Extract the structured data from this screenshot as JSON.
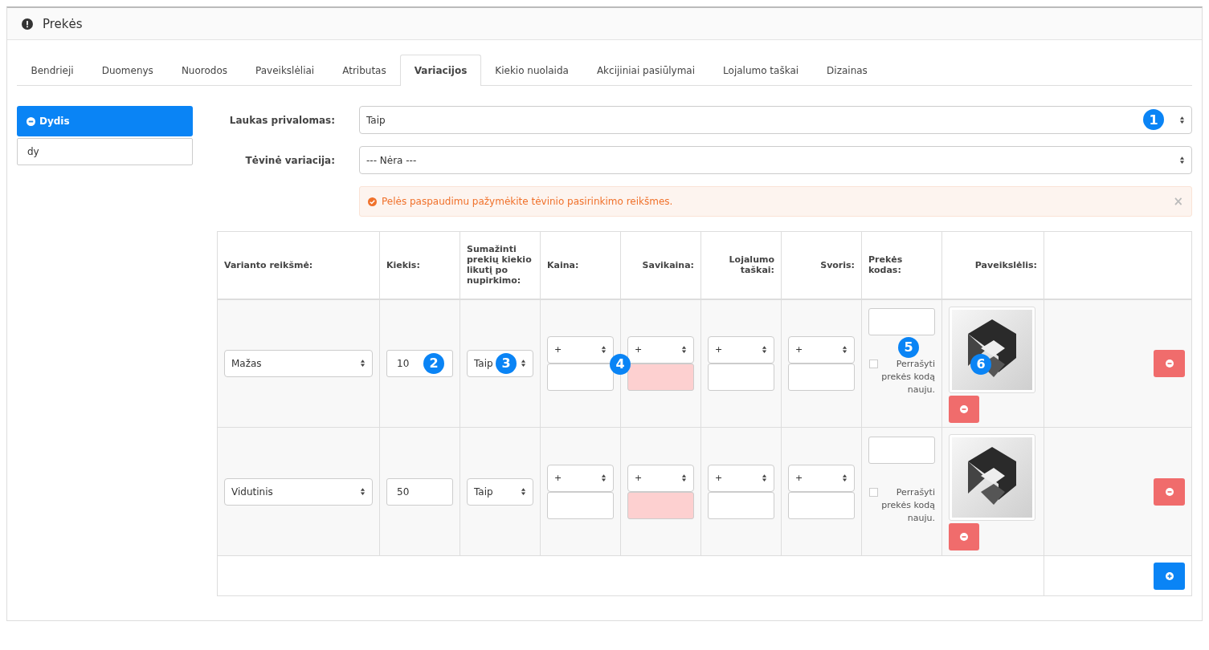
{
  "panel": {
    "title": "Prekės"
  },
  "tabs": [
    {
      "label": "Bendrieji",
      "selected": false
    },
    {
      "label": "Duomenys",
      "selected": false
    },
    {
      "label": "Nuorodos",
      "selected": false
    },
    {
      "label": "Paveikslėliai",
      "selected": false
    },
    {
      "label": "Atributas",
      "selected": false
    },
    {
      "label": "Variacijos",
      "selected": true
    },
    {
      "label": "Kiekio nuolaida",
      "selected": false
    },
    {
      "label": "Akcijiniai pasiūlymai",
      "selected": false
    },
    {
      "label": "Lojalumo taškai",
      "selected": false
    },
    {
      "label": "Dizainas",
      "selected": false
    }
  ],
  "sidebar": {
    "items": [
      {
        "label": "Dydis",
        "selected": true
      }
    ],
    "search": {
      "value": "dy"
    }
  },
  "form": {
    "fields": [
      {
        "label": "Laukas privalomas:",
        "value": "Taip",
        "callout": "1"
      },
      {
        "label": "Tėvinė variacija:",
        "value": "--- Nėra ---"
      }
    ],
    "alert": {
      "text": "Pelės paspaudimu pažymėkite tėvinio pasirinkimo reikšmes.",
      "close": "×"
    }
  },
  "table": {
    "columns": [
      "Varianto reikšmė:",
      "Kiekis:",
      "Sumažinti prekių kiekio likutį po nupirkimo:",
      "Kaina:",
      "Savikaina:",
      "Lojalumo taškai:",
      "Svoris:",
      "Prekės kodas:",
      "Paveikslėlis:"
    ],
    "rows": [
      {
        "value": "Mažas",
        "quantity": "10",
        "subtract": "Taip",
        "price": "+",
        "cost": "+",
        "cost_error": true,
        "points": "+",
        "weight": "+",
        "overwrite_label": "Perrašyti prekės kodą nauju.",
        "overwrite_checked": false,
        "callouts": {
          "quantity": "2",
          "subtract": "3",
          "price": "4",
          "code": "5",
          "image": "6"
        }
      },
      {
        "value": "Vidutinis",
        "quantity": "50",
        "subtract": "Taip",
        "price": "+",
        "cost": "+",
        "cost_error": true,
        "points": "+",
        "weight": "+",
        "overwrite_label": "Perrašyti prekės kodą nauju.",
        "overwrite_checked": false
      }
    ]
  }
}
